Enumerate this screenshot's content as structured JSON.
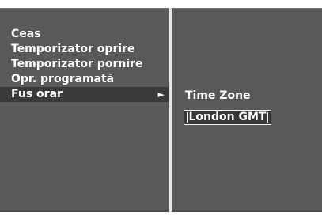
{
  "menu": {
    "items": [
      {
        "label": "Ceas"
      },
      {
        "label": "Temporizator oprire"
      },
      {
        "label": "Temporizator pornire"
      },
      {
        "label": "Opr. programată"
      },
      {
        "label": "Fus orar",
        "selected": true,
        "arrow": "►"
      }
    ]
  },
  "submenu": {
    "title": "Time Zone",
    "value": "London GMT"
  },
  "colors": {
    "panel_bg": "#58595a",
    "selected_bg": "#3a3a3b",
    "text": "#ffffff"
  }
}
